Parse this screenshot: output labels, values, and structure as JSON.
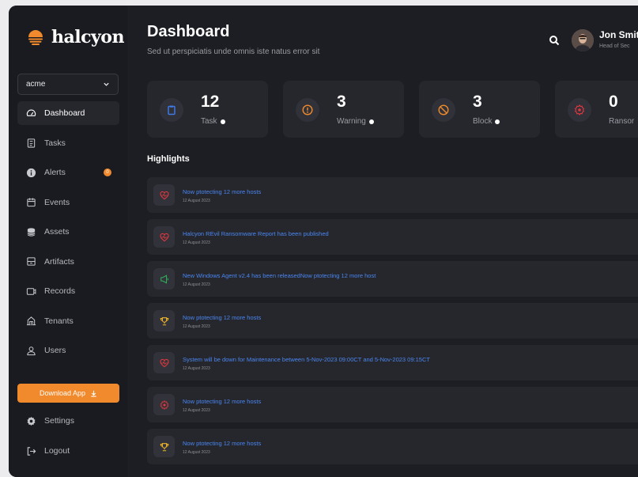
{
  "brand": {
    "name": "halcyon",
    "accent": "#f08a2c"
  },
  "org_select": {
    "value": "acme"
  },
  "nav": {
    "items": [
      {
        "label": "Dashboard",
        "icon": "dashboard-gauge-icon",
        "active": true
      },
      {
        "label": "Tasks",
        "icon": "clipboard-icon"
      },
      {
        "label": "Alerts",
        "icon": "info-circle-icon",
        "badge": "0"
      },
      {
        "label": "Events",
        "icon": "calendar-icon"
      },
      {
        "label": "Assets",
        "icon": "database-icon"
      },
      {
        "label": "Artifacts",
        "icon": "archive-box-icon"
      },
      {
        "label": "Records",
        "icon": "screen-icon"
      },
      {
        "label": "Tenants",
        "icon": "building-icon"
      },
      {
        "label": "Users",
        "icon": "user-icon"
      }
    ],
    "download_label": "Download App",
    "bottom": [
      {
        "label": "Settings",
        "icon": "gear-icon"
      },
      {
        "label": "Logout",
        "icon": "logout-icon"
      }
    ]
  },
  "header": {
    "title": "Dashboard",
    "subtitle": "Sed ut perspiciatis unde omnis iste natus error sit",
    "user_name": "Jon Smit",
    "user_role": "Head of Sec"
  },
  "stats": [
    {
      "value": "12",
      "label": "Task",
      "icon": "clipboard-icon",
      "color": "#3f7be8"
    },
    {
      "value": "3",
      "label": "Warning",
      "icon": "warning-circle-icon",
      "color": "#f08a2c"
    },
    {
      "value": "3",
      "label": "Block",
      "icon": "block-icon",
      "color": "#f08a2c"
    },
    {
      "value": "0",
      "label": "Ransor",
      "icon": "bug-gear-icon",
      "color": "#e0383e"
    }
  ],
  "highlights": {
    "title": "Highlights",
    "items": [
      {
        "title": "Now ptotecting 12 more hosts",
        "date": "12 August 2023",
        "icon": "heart-pulse-icon",
        "color": "#e0383e"
      },
      {
        "title": "Halcyon REvil Ransomware Report has been published",
        "date": "12 August 2023",
        "icon": "heart-pulse-icon",
        "color": "#e0383e"
      },
      {
        "title": "New Windows Agent v2.4 has been releasedNow ptotecting 12 more host",
        "date": "12 August 2023",
        "icon": "megaphone-icon",
        "color": "#2fb25a"
      },
      {
        "title": "Now ptotecting 12 more hosts",
        "date": "12 August 2023",
        "icon": "trophy-icon",
        "color": "#f0b429"
      },
      {
        "title": "System will be down for Maintenance between 5-Nov-2023 09:00CT and 5-Nov-2023 09:15CT",
        "date": "12 August 2023",
        "icon": "heart-pulse-icon",
        "color": "#e0383e"
      },
      {
        "title": "Now ptotecting 12 more hosts",
        "date": "12 August 2023",
        "icon": "bug-gear-icon",
        "color": "#e0383e"
      },
      {
        "title": "Now ptotecting 12 more hosts",
        "date": "12 August 2023",
        "icon": "trophy-icon",
        "color": "#f0b429"
      }
    ]
  }
}
